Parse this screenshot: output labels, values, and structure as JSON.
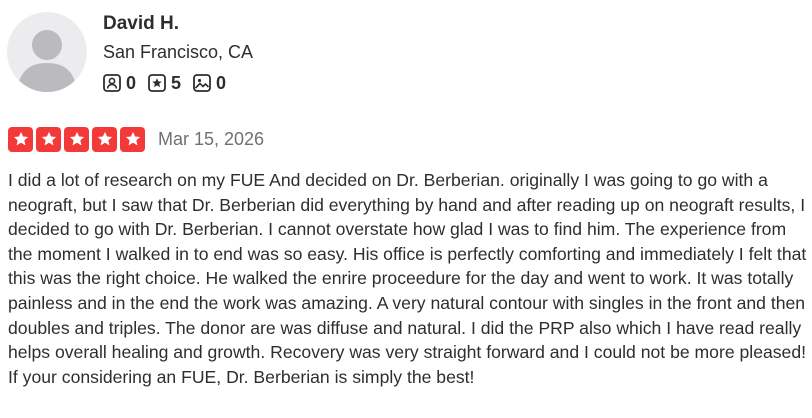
{
  "user": {
    "name": "David H.",
    "location": "San Francisco, CA",
    "stats": {
      "friends": "0",
      "reviews": "5",
      "photos": "0"
    }
  },
  "review": {
    "rating": 5,
    "rating_max": 5,
    "date": "Mar 15, 2026",
    "text": "I did a lot of research on my FUE And decided on Dr. Berberian. originally I was going to go with a neograft, but I saw that Dr. Berberian did everything by hand and after reading up on neograft results, I decided to go with Dr. Berberian. I cannot overstate how glad I was to find him. The experience from the moment I walked in to end was so easy. His office is perfectly comforting and immediately I felt that this was the right choice. He walked the enrire proceedure for the day and went to work. It was totally painless and in the end the work was amazing. A very natural contour with singles in the front and then doubles and triples. The donor are was diffuse and natural. I did the PRP also which I have read really helps overall healing and growth. Recovery was very straight forward and I could not be more pleased! If your considering an FUE, Dr. Berberian is simply the best!"
  },
  "colors": {
    "star_fill": "#f43939",
    "text_primary": "#2d2e2f",
    "text_secondary": "#6e7072",
    "avatar_bg": "#ececee",
    "avatar_figure": "#bbbbbf"
  },
  "icons": {
    "friends": "friends-icon",
    "reviews": "review-star-icon",
    "photos": "photo-icon",
    "star": "star-icon"
  }
}
